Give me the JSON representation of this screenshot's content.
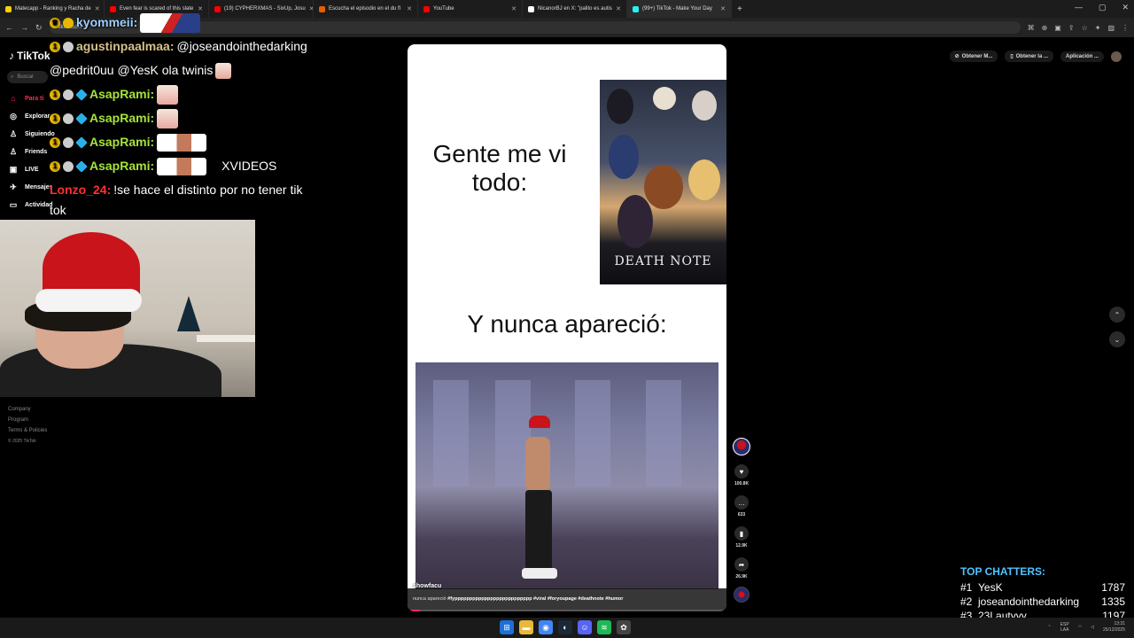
{
  "browser": {
    "tabs": [
      {
        "title": "Matecapp - Ranking y Racha de",
        "color": "#ffd000"
      },
      {
        "title": "Even fear is scared of this slate",
        "color": "#ff0000"
      },
      {
        "title": "(19) CYPHERXMAS - SixUp, Josu",
        "color": "#ff0000"
      },
      {
        "title": "Escucha el episodio en el du fl",
        "color": "#e66000"
      },
      {
        "title": "YouTube",
        "color": "#ff0000"
      },
      {
        "title": "NicanorBJ en X: \"palito es autis",
        "color": "#ffffff"
      },
      {
        "title": "(99+) TikTok - Make Your Day",
        "color": "#25f4ee"
      }
    ],
    "new_tab": "+",
    "url": "tiktok.com"
  },
  "tiktok": {
    "logo": "TikTok",
    "search_placeholder": "Buscar",
    "nav": [
      {
        "label": "Para ti",
        "icon": "home-icon",
        "glyph": "⌂"
      },
      {
        "label": "Explorar",
        "icon": "compass-icon",
        "glyph": "◎"
      },
      {
        "label": "Siguiendo",
        "icon": "following-icon",
        "glyph": "♙"
      },
      {
        "label": "Friends",
        "icon": "friends-icon",
        "glyph": "♙"
      },
      {
        "label": "LIVE",
        "icon": "live-icon",
        "glyph": "▣"
      },
      {
        "label": "Mensajes",
        "icon": "messages-icon",
        "glyph": "✈"
      },
      {
        "label": "Actividad",
        "icon": "activity-icon",
        "glyph": "▭"
      }
    ],
    "footer": [
      "Company",
      "Program",
      "Terms & Policies"
    ],
    "copyright": "© 2025 TikTok",
    "top_right": {
      "btn1": "Obtener M...",
      "btn2": "Obtener la ...",
      "btn3": "Aplicación ..."
    },
    "video": {
      "top_text": "Gente me vi todo:",
      "poster_title": "DEATH NOTE",
      "mid_text": "Y nunca apareció:",
      "author": "showfacu",
      "caption_start": "nunca apareció ",
      "caption_tags": "#fypppppppppppppppppppppppppp #viral #foryoupage #deathnote #humor",
      "progress": 0.04
    },
    "actions": {
      "likes": "100.8K",
      "comments": "633",
      "saves": "12.9K",
      "shares": "26.9K"
    }
  },
  "chat": [
    {
      "user": "kyommeii:",
      "text": "",
      "style": "user-cyan",
      "emote": "banner",
      "badges": "crown"
    },
    {
      "user": "agustinpaalmaa:",
      "text": "@joseandointhedarking",
      "style": "user-gold",
      "emote": "",
      "badges": "gold-gray"
    },
    {
      "user": "",
      "text": "@pedrit0uu @YesK ola twinis",
      "style": "",
      "emote": "",
      "badges": ""
    },
    {
      "user": "AsapRami:",
      "text": "",
      "style": "user-green",
      "emote": "small",
      "badges": "gold-gray-cyan"
    },
    {
      "user": "AsapRami:",
      "text": "",
      "style": "user-green",
      "emote": "small",
      "badges": "gold-gray-cyan"
    },
    {
      "user": "AsapRami:",
      "text": "",
      "style": "user-green",
      "emote": "wide",
      "badges": "gold-gray-cyan"
    },
    {
      "user": "AsapRami:",
      "text": "XVIDEOS",
      "style": "user-green",
      "emote": "wide",
      "badges": "gold-gray-cyan"
    },
    {
      "user": "Lonzo_24:",
      "text": "!se hace el distinto por no tener tik",
      "style": "user-red",
      "emote": "",
      "badges": ""
    },
    {
      "user": "",
      "text": "tok",
      "style": "",
      "emote": "",
      "badges": ""
    }
  ],
  "top_chatters": {
    "title": "TOP CHATTERS:",
    "rows": [
      {
        "rank": "#1",
        "name": "YesK",
        "count": "1787"
      },
      {
        "rank": "#2",
        "name": "joseandointhedarking",
        "count": "1335"
      },
      {
        "rank": "#3",
        "name": "23Lautyyy",
        "count": "1197"
      }
    ]
  },
  "taskbar": {
    "lang": "ESP",
    "lang2": "LAA",
    "time": "13:31",
    "date": "25/12/2025"
  }
}
